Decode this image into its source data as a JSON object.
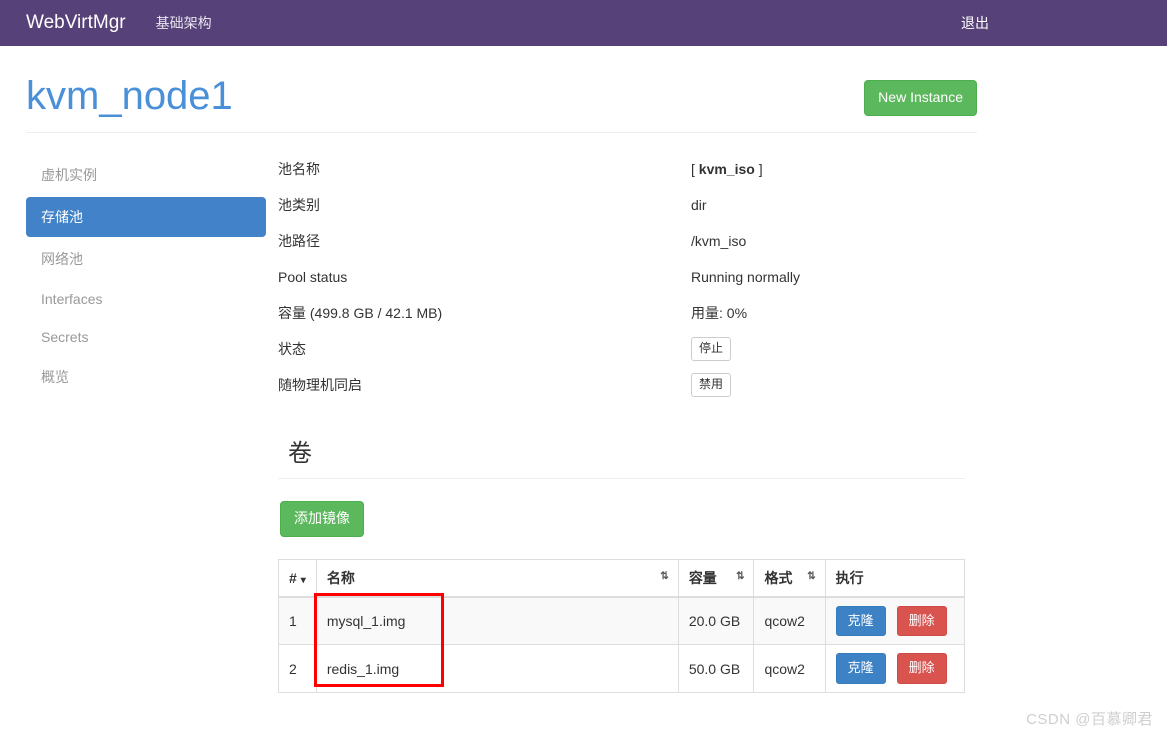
{
  "navbar": {
    "brand": "WebVirtMgr",
    "links": [
      {
        "label": "基础架构",
        "name": "nav-infrastructure"
      }
    ],
    "logout_label": "退出",
    "background": "#564179"
  },
  "header": {
    "title": "kvm_node1",
    "title_color": "#4a90d9",
    "new_instance_label": "New Instance",
    "new_instance_color": "#5cb85c"
  },
  "sidebar": {
    "items": [
      {
        "label": "虚机实例",
        "name": "sidebar-item-instances",
        "active": false
      },
      {
        "label": "存储池",
        "name": "sidebar-item-storages",
        "active": true
      },
      {
        "label": "网络池",
        "name": "sidebar-item-networks",
        "active": false
      },
      {
        "label": "Interfaces",
        "name": "sidebar-item-interfaces",
        "active": false
      },
      {
        "label": "Secrets",
        "name": "sidebar-item-secrets",
        "active": false
      },
      {
        "label": "概览",
        "name": "sidebar-item-overview",
        "active": false
      }
    ],
    "active_color": "#4282c8"
  },
  "pool": {
    "rows": [
      {
        "label": "池名称",
        "value_prefix": "[ ",
        "value_bold": "kvm_iso",
        "value_suffix": " ]",
        "type": "text-bold"
      },
      {
        "label": "池类别",
        "value": "dir",
        "type": "text"
      },
      {
        "label": "池路径",
        "value": "/kvm_iso",
        "type": "text"
      },
      {
        "label": "Pool status",
        "value": "Running normally",
        "type": "text"
      },
      {
        "label": "容量 (499.8 GB / 42.1 MB)",
        "value": "用量: 0%",
        "type": "text"
      },
      {
        "label": "状态",
        "value": "停止",
        "type": "button"
      },
      {
        "label": "随物理机同启",
        "value": "禁用",
        "type": "button"
      }
    ]
  },
  "volumes": {
    "section_title": "卷",
    "add_image_label": "添加镜像",
    "columns": [
      {
        "label": "#",
        "sort": "down"
      },
      {
        "label": "名称",
        "sort": "both"
      },
      {
        "label": "容量",
        "sort": "both"
      },
      {
        "label": "格式",
        "sort": "both"
      },
      {
        "label": "执行",
        "sort": "none"
      }
    ],
    "rows": [
      {
        "num": "1",
        "name": "mysql_1.img",
        "size": "20.0 GB",
        "format": "qcow2",
        "clone_label": "克隆",
        "delete_label": "删除"
      },
      {
        "num": "2",
        "name": "redis_1.img",
        "size": "50.0 GB",
        "format": "qcow2",
        "clone_label": "克隆",
        "delete_label": "删除"
      }
    ],
    "clone_color": "#3d82c4",
    "delete_color": "#d9534f"
  },
  "annotation": {
    "color": "#ff0000"
  },
  "watermark": {
    "text": "CSDN @百慕卿君"
  }
}
